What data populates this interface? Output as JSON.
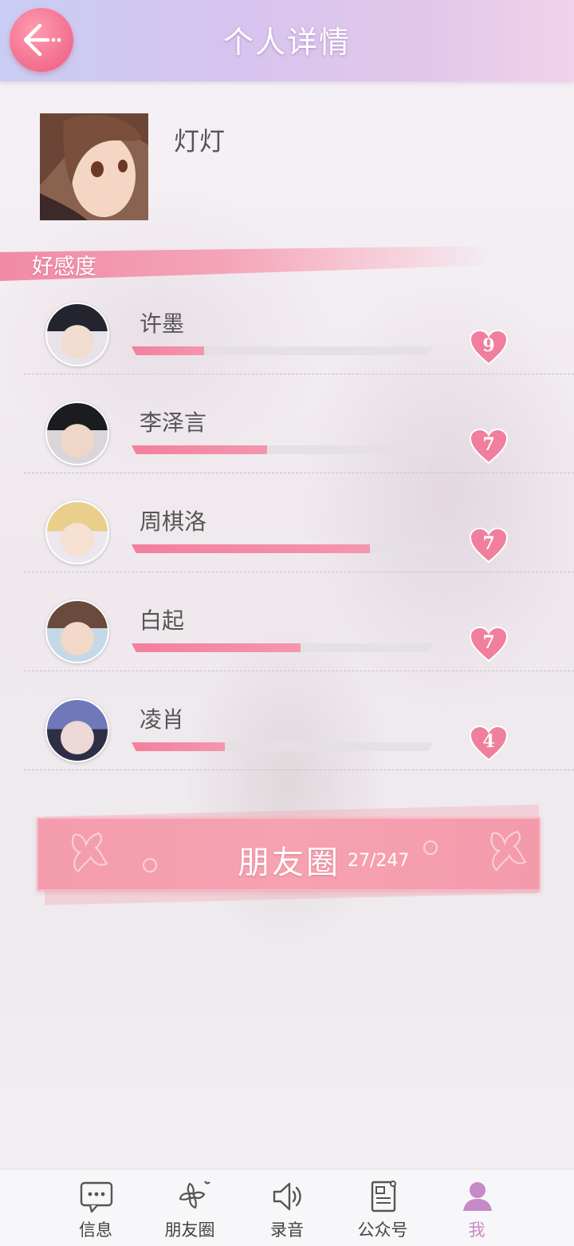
{
  "header": {
    "title": "个人详情"
  },
  "profile": {
    "name": "灯灯"
  },
  "affinity": {
    "section_title": "好感度",
    "characters": [
      {
        "name": "许墨",
        "progress": 0.24,
        "level": "9"
      },
      {
        "name": "李泽言",
        "progress": 0.45,
        "level": "7"
      },
      {
        "name": "周棋洛",
        "progress": 0.79,
        "level": "7"
      },
      {
        "name": "白起",
        "progress": 0.56,
        "level": "7"
      },
      {
        "name": "凌肖",
        "progress": 0.31,
        "level": "4"
      }
    ]
  },
  "moments": {
    "label": "朋友圈",
    "count": "27/247"
  },
  "nav": {
    "items": [
      {
        "label": "信息",
        "icon": "chat-bubble-icon"
      },
      {
        "label": "朋友圈",
        "icon": "sakura-flower-icon"
      },
      {
        "label": "录音",
        "icon": "speaker-icon"
      },
      {
        "label": "公众号",
        "icon": "document-icon"
      },
      {
        "label": "我",
        "icon": "person-icon"
      }
    ],
    "active": "我"
  },
  "colors": {
    "accent": "#f37f9d",
    "header": "#d6c4ee",
    "active_nav": "#c68ac6"
  }
}
